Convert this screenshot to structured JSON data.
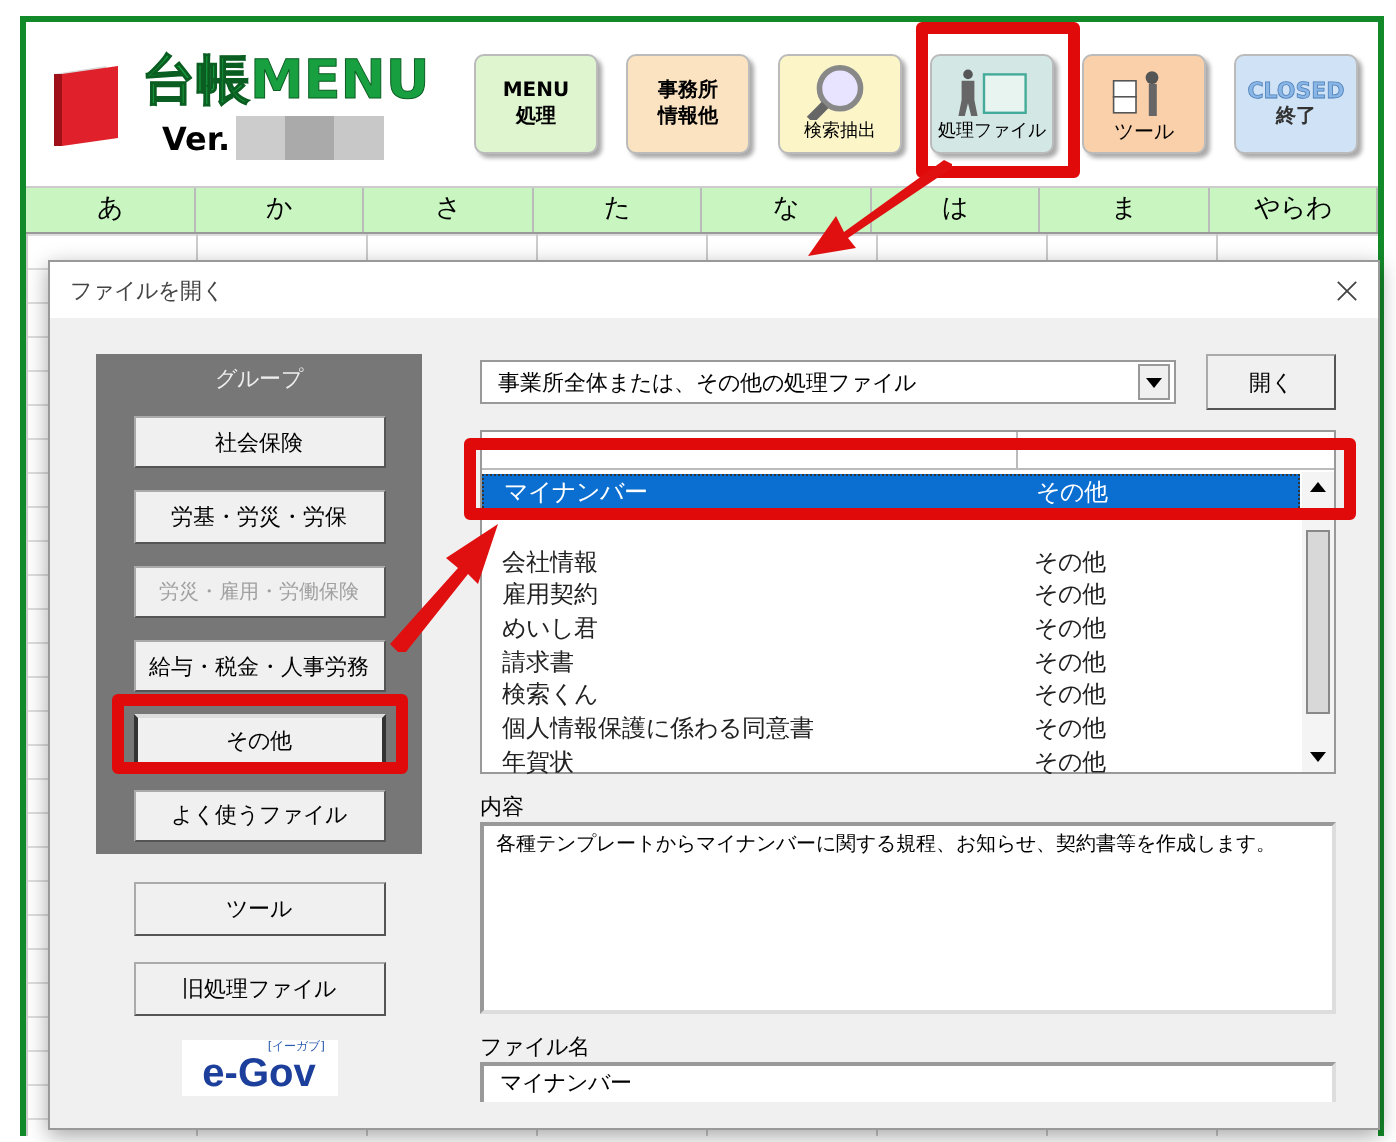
{
  "header": {
    "title": "台帳MENU",
    "version_label": "Ver.",
    "toolbar": [
      {
        "kind": "menu",
        "lines": [
          "MENU",
          "処理"
        ]
      },
      {
        "kind": "office",
        "lines": [
          "事務所",
          "情報他"
        ]
      },
      {
        "kind": "search",
        "lines": [
          "検索抽出"
        ]
      },
      {
        "kind": "files",
        "lines": [
          "処理ファイル"
        ]
      },
      {
        "kind": "tool",
        "lines": [
          "ツール"
        ]
      },
      {
        "kind": "close",
        "lines": [
          "CLOSED",
          "終了"
        ]
      }
    ]
  },
  "kana_row": [
    "あ",
    "か",
    "さ",
    "た",
    "な",
    "は",
    "ま",
    "やらわ"
  ],
  "dialog": {
    "title": "ファイルを開く",
    "group_panel": {
      "title": "グループ",
      "buttons": [
        {
          "label": "社会保険",
          "disabled": false,
          "selected": false
        },
        {
          "label": "労基・労災・労保",
          "disabled": false,
          "selected": false
        },
        {
          "label": "労災・雇用・労働保険",
          "disabled": true,
          "selected": false
        },
        {
          "label": "給与・税金・人事労務",
          "disabled": false,
          "selected": false
        },
        {
          "label": "その他",
          "disabled": false,
          "selected": true
        },
        {
          "label": "よく使うファイル",
          "disabled": false,
          "selected": false
        }
      ]
    },
    "extra_buttons": [
      "ツール",
      "旧処理ファイル"
    ],
    "logo": {
      "text": "e-Gov",
      "tag": "[イーガブ]"
    },
    "category_select": {
      "value": "事業所全体または、その他の処理ファイル"
    },
    "open_button": "開く",
    "file_list": {
      "rows": [
        {
          "name": "マイナンバー",
          "group": "その他",
          "selected": true
        },
        {
          "name": "会社情報",
          "group": "その他",
          "selected": false
        },
        {
          "name": "雇用契約",
          "group": "その他",
          "selected": false
        },
        {
          "name": "めいし君",
          "group": "その他",
          "selected": false
        },
        {
          "name": "請求書",
          "group": "その他",
          "selected": false
        },
        {
          "name": "検索くん",
          "group": "その他",
          "selected": false
        },
        {
          "name": "個人情報保護に係わる同意書",
          "group": "その他",
          "selected": false
        },
        {
          "name": "年賀状",
          "group": "その他",
          "selected": false
        }
      ]
    },
    "description": {
      "label": "内容",
      "text": "各種テンプレートからマイナンバーに関する規程、お知らせ、契約書等を作成します。"
    },
    "filename": {
      "label": "ファイル名",
      "value": "マイナンバー"
    }
  }
}
